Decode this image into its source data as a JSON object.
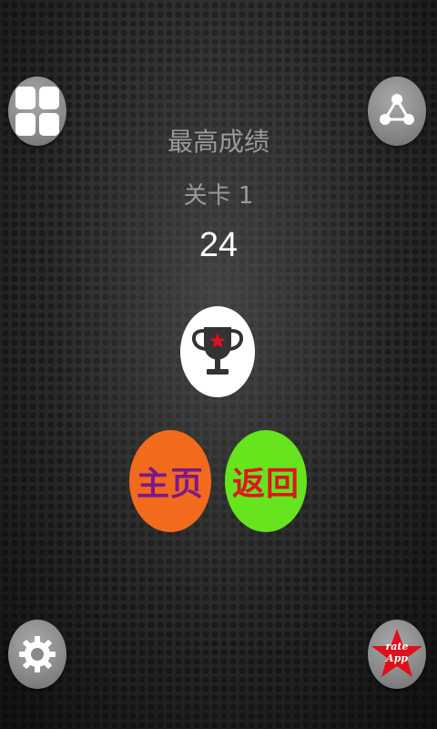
{
  "best_title": "最高成绩",
  "level_label": "关卡 1",
  "best_score": "24",
  "buttons": {
    "home_label": "主页",
    "back_label": "返回",
    "rate_line1": "rate",
    "rate_line2": "App"
  },
  "icons": {
    "menu": "grid-icon",
    "share": "share-icon",
    "settings": "gear-icon",
    "rate": "star-icon",
    "trophy": "trophy-icon"
  },
  "colors": {
    "home_button_bg": "#f26a1b",
    "home_button_text": "#7a1a8a",
    "back_button_bg": "#66e41e",
    "back_button_text": "#e0141e",
    "rate_star": "#e0101a"
  }
}
